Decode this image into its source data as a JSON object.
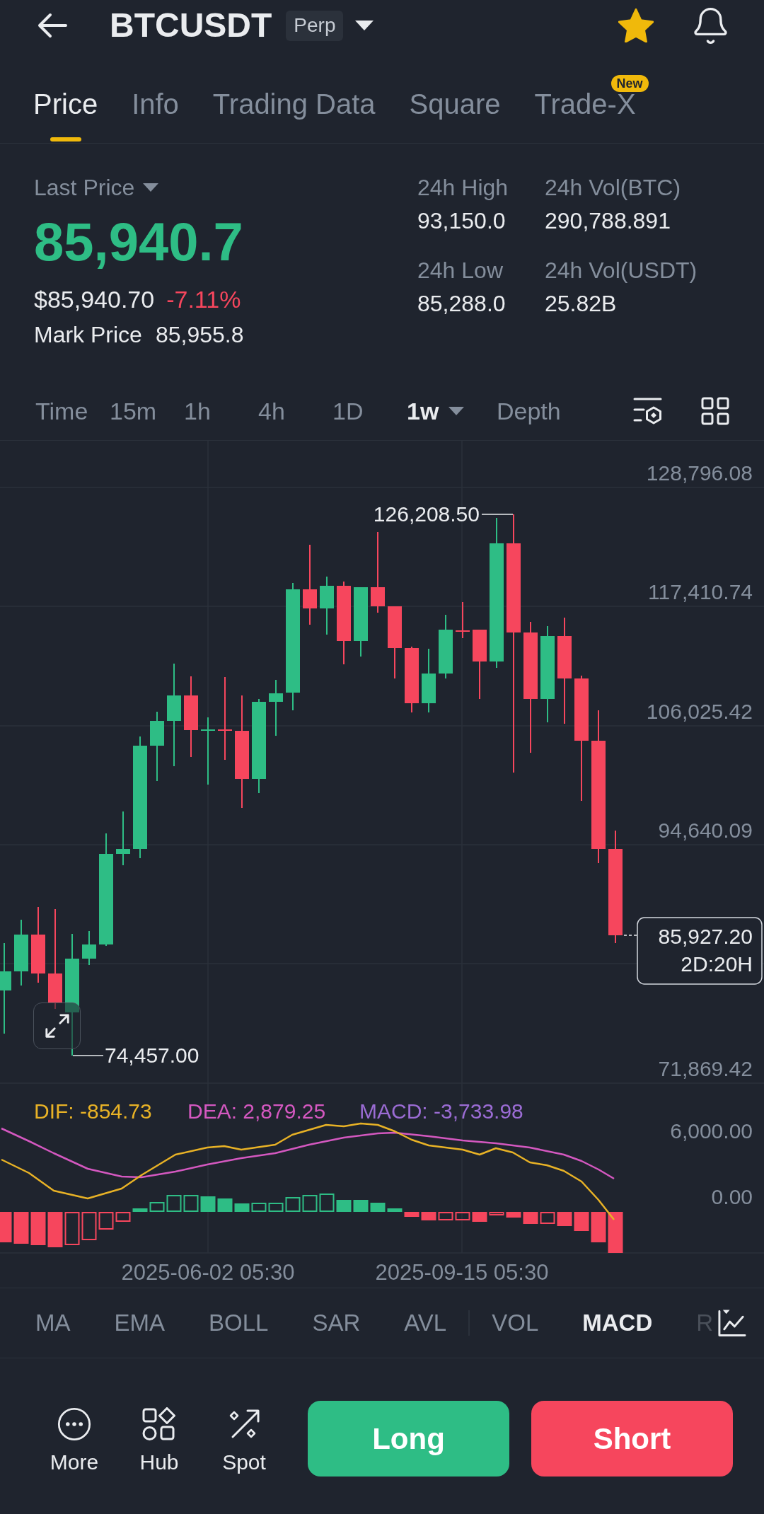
{
  "header": {
    "symbol": "BTCUSDT",
    "contract_badge": "Perp",
    "favorite": true
  },
  "tabs": [
    {
      "label": "Price",
      "selected": true
    },
    {
      "label": "Info",
      "selected": false
    },
    {
      "label": "Trading Data",
      "selected": false
    },
    {
      "label": "Square",
      "selected": false
    },
    {
      "label": "Trade-X",
      "selected": false,
      "badge": "New"
    }
  ],
  "price": {
    "last_price_label": "Last Price",
    "last_price": "85,940.7",
    "last_price_up": true,
    "fiat_price": "$85,940.70",
    "change": "-7.11%",
    "change_up": false,
    "mark_price_label": "Mark Price",
    "mark_price": "85,955.8"
  },
  "stats": [
    {
      "label": "24h High",
      "value": "93,150.0"
    },
    {
      "label": "24h Vol(BTC)",
      "value": "290,788.891"
    },
    {
      "label": "24h Low",
      "value": "85,288.0"
    },
    {
      "label": "24h Vol(USDT)",
      "value": "25.82B"
    }
  ],
  "timeframes": [
    {
      "label": "Time",
      "selected": false,
      "dropdown": false
    },
    {
      "label": "15m",
      "selected": false,
      "dropdown": false
    },
    {
      "label": "1h",
      "selected": false,
      "dropdown": false
    },
    {
      "label": "4h",
      "selected": false,
      "dropdown": false
    },
    {
      "label": "1D",
      "selected": false,
      "dropdown": false
    },
    {
      "label": "1w",
      "selected": true,
      "dropdown": true
    },
    {
      "label": "Depth",
      "selected": false,
      "dropdown": false
    }
  ],
  "chart": {
    "price_axis": [
      "128,796.08",
      "117,410.74",
      "106,025.42",
      "94,640.09",
      "71,869.42"
    ],
    "high_label": "126,208.50",
    "low_label": "74,457.00",
    "price_tag": {
      "price": "85,927.20",
      "countdown": "2D:20H"
    },
    "macd_legend": [
      {
        "label": "DIF: -854.73",
        "color": "#e8b226"
      },
      {
        "label": "DEA: 2,879.25",
        "color": "#d458c0"
      },
      {
        "label": "MACD: -3,733.98",
        "color": "#9b6cd4"
      }
    ],
    "macd_axis": [
      "6,000.00",
      "0.00"
    ],
    "time_axis": [
      "2025-06-02 05:30",
      "2025-09-15 05:30"
    ]
  },
  "indicators": {
    "main": [
      {
        "label": "MA",
        "selected": false
      },
      {
        "label": "EMA",
        "selected": false
      },
      {
        "label": "BOLL",
        "selected": false
      },
      {
        "label": "SAR",
        "selected": false
      },
      {
        "label": "AVL",
        "selected": false
      }
    ],
    "sub": [
      {
        "label": "VOL",
        "selected": false
      },
      {
        "label": "MACD",
        "selected": true
      },
      {
        "label": "R",
        "selected": false
      }
    ]
  },
  "actions": [
    {
      "label": "More"
    },
    {
      "label": "Hub"
    },
    {
      "label": "Spot"
    }
  ],
  "trade_buttons": [
    {
      "label": "Long",
      "kind": "buy"
    },
    {
      "label": "Short",
      "kind": "sell"
    }
  ]
}
